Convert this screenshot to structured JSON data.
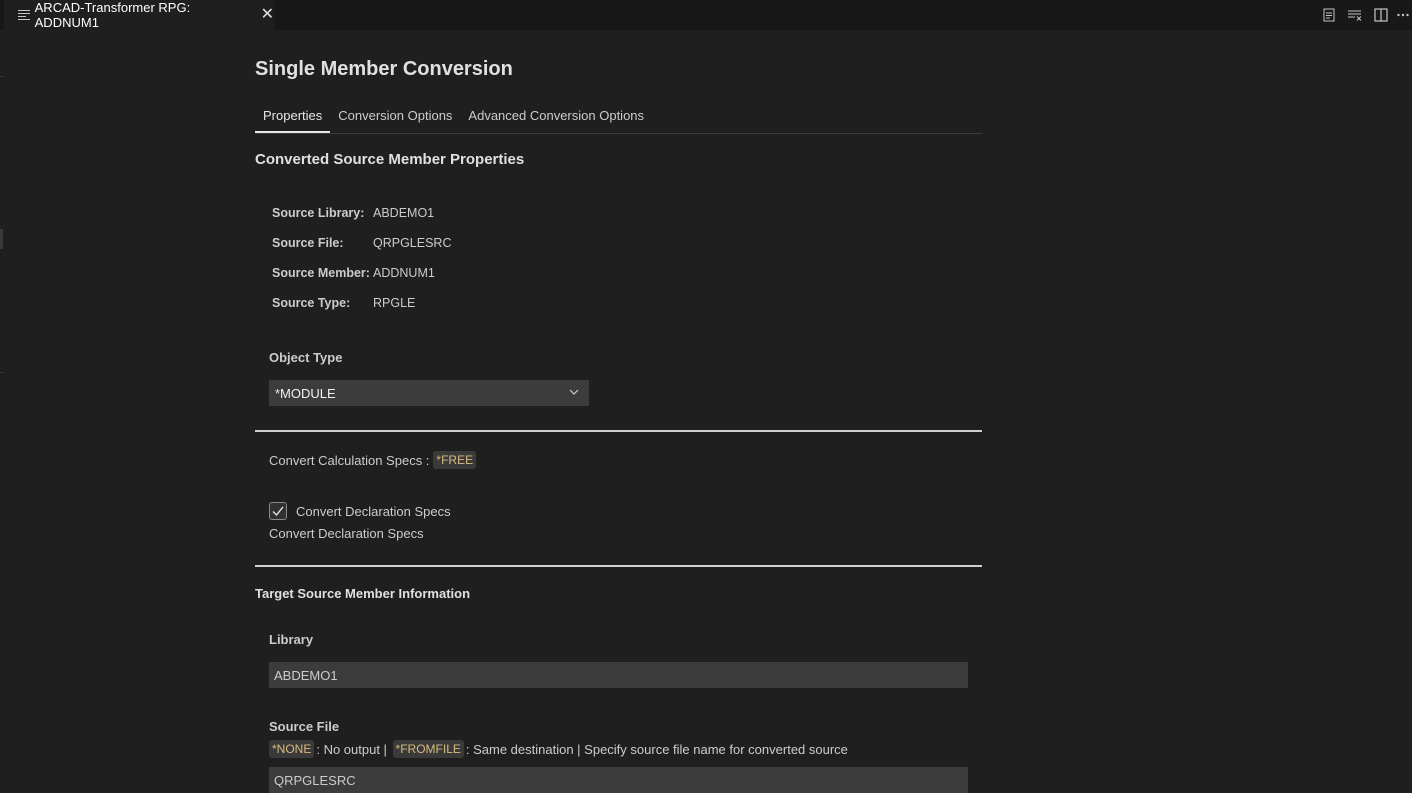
{
  "editor": {
    "tab_title": "ARCAD-Transformer RPG: ADDNUM1",
    "close_glyph": "✕",
    "actions": [
      {
        "name": "open-preview-icon"
      },
      {
        "name": "clear-all-icon"
      },
      {
        "name": "split-editor-icon"
      },
      {
        "name": "more-actions-icon"
      }
    ]
  },
  "page": {
    "title": "Single Member Conversion",
    "tabs": [
      {
        "label": "Properties",
        "active": true
      },
      {
        "label": "Conversion Options",
        "active": false
      },
      {
        "label": "Advanced Conversion Options",
        "active": false
      }
    ]
  },
  "source_properties": {
    "heading": "Converted Source Member Properties",
    "rows": [
      {
        "key": "Source Library:",
        "value": "ABDEMO1"
      },
      {
        "key": "Source File:",
        "value": "QRPGLESRC"
      },
      {
        "key": "Source Member:",
        "value": "ADDNUM1"
      },
      {
        "key": "Source Type:",
        "value": "RPGLE"
      }
    ]
  },
  "object_type": {
    "label": "Object Type",
    "selected": "*MODULE"
  },
  "conversion": {
    "calc_specs_label": "Convert Calculation Specs :",
    "calc_specs_value": "*FREE",
    "decl_specs_checkbox_label": "Convert Declaration Specs",
    "decl_specs_checked": true,
    "decl_specs_description": "Convert Declaration Specs"
  },
  "target": {
    "heading": "Target Source Member Information",
    "library_label": "Library",
    "library_value": "ABDEMO1",
    "source_file_label": "Source File",
    "source_file_hint": {
      "none_badge": "*NONE",
      "none_text": ": No output | ",
      "fromfile_badge": "*FROMFILE",
      "fromfile_text": ": Same destination | Specify source file name for converted source"
    },
    "source_file_value": "QRPGLESRC"
  },
  "colors": {
    "background": "#1f1f1f",
    "tabbar": "#181818",
    "input_bg": "#3c3c3c",
    "badge_text": "#d7ba7d",
    "divider": "#d0d0d0"
  }
}
